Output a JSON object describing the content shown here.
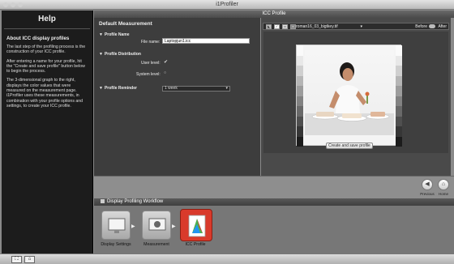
{
  "window": {
    "title": "i1Profiler"
  },
  "help": {
    "title": "Help",
    "heading": "About ICC display profiles",
    "paragraphs": [
      "The last step of the profiling process is the construction of your ICC profile.",
      "After entering a name for your profile, hit the \"Create and save profile\" button below to begin the process.",
      "The 3-dimensional graph to the right, displays the color values that were measured on the measurement page. i1Profiler uses these measurements, in combination with your profile options and settings, to create your ICC profile."
    ]
  },
  "panel": {
    "title": "ICC Profile"
  },
  "settings": {
    "title": "Default Measurement",
    "profile_name_section": "Profile Name",
    "file_name_label": "File name:",
    "file_name_value": "Laptopjun1.icc",
    "distribution_section": "Profile Distribution",
    "user_level_label": "User level:",
    "system_level_label": "System level:",
    "reminder_label": "Profile Reminder",
    "reminder_value": "1 week"
  },
  "preview": {
    "image_name": "roman16_03_bigtkey.tif",
    "before_label": "Before",
    "after_label": "After",
    "create_button": "Create and save profile"
  },
  "nav": {
    "previous_label": "Previous",
    "home_label": "Home"
  },
  "workflow": {
    "title": "Display Profiling Workflow",
    "steps": [
      {
        "label": "Display Settings"
      },
      {
        "label": "Measurement"
      },
      {
        "label": "ICC Profile"
      }
    ]
  },
  "colors": {
    "accent": "#d93a2b",
    "panel": "#3d3d3d",
    "help_bg": "#1c1c1c"
  }
}
